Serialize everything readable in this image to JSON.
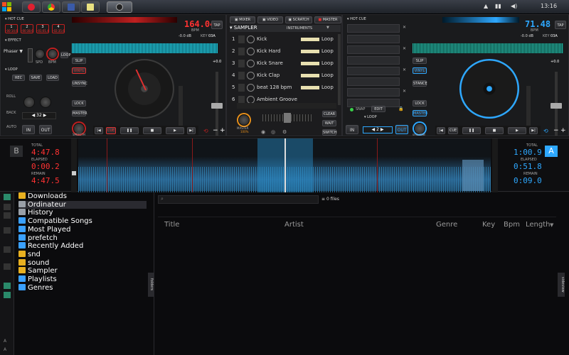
{
  "taskbar": {
    "clock": "13:16"
  },
  "left_deck": {
    "hot_cue_label": "HOT CUE",
    "hot_cues": [
      {
        "num": "1",
        "time": "-00:14.6"
      },
      {
        "num": "2",
        "time": "-00:38.6"
      },
      {
        "num": "3",
        "time": "-01:01.4"
      },
      {
        "num": "4",
        "time": "-02:35.6"
      }
    ],
    "bpm": "164.04",
    "bpm_unit": "BPM",
    "gain": "-0.0 dB",
    "key_label": "KEY",
    "key": "03A",
    "tap": "TAP",
    "effect_label": "EFFECT",
    "effect_name": "Phaser",
    "effect_knobs": [
      "SPD",
      "BPM"
    ],
    "loop_btn": "LOOP",
    "loop_label": "LOOP",
    "loop_buttons": [
      "REC",
      "SAVE",
      "LOAD"
    ],
    "side_labels": [
      "ROLL",
      "BACK",
      "AUTO"
    ],
    "loop_size": "32",
    "loop_in": "IN",
    "loop_out": "OUT",
    "pitch": "+0.0",
    "right_buttons": [
      "SLIP",
      "VINYL",
      "UNSYNC",
      "LOCK",
      "MASTER"
    ],
    "smooth": "SMOOTH",
    "transport": {
      "cue": "CUE"
    }
  },
  "right_deck": {
    "hot_cue_label": "HOT CUE",
    "bpm": "71.48",
    "bpm_unit": "BPM",
    "gain": "-0.0 dB",
    "key_label": "KEY",
    "key": "03A",
    "tap": "TAP",
    "pitch": "+0.0",
    "left_buttons": [
      "SLIP",
      "VINYL",
      "STANCE",
      "LOCK",
      "MASTER"
    ],
    "snap": "SNAP",
    "edit": "EDIT",
    "loop_label": "LOOP",
    "loop_in": "IN",
    "loop_out": "OUT",
    "loop_size": "2",
    "smooth": "smoothB",
    "transport": {
      "cue": "CUE"
    }
  },
  "center": {
    "tabs": [
      "MIXER",
      "VIDEO",
      "SCRATCH",
      "MASTER"
    ],
    "sampler_title": "SAMPLER",
    "sampler_mode": "INSTRUMENTS",
    "samples": [
      {
        "num": "1",
        "name": "Kick",
        "mode": "Loop"
      },
      {
        "num": "2",
        "name": "Kick Hard",
        "mode": "Loop"
      },
      {
        "num": "3",
        "name": "Kick Snare",
        "mode": "Loop"
      },
      {
        "num": "4",
        "name": "Kick Clap",
        "mode": "Loop"
      },
      {
        "num": "5",
        "name": "beat 128 bpm",
        "mode": "Loop"
      },
      {
        "num": "6",
        "name": "Ambient Groove",
        "mode": ""
      }
    ],
    "master_knob_label": "MASTER",
    "master_percent": "100%",
    "side_buttons": [
      "CLEAR",
      "WAIT",
      "SWITCH"
    ]
  },
  "waveform_bar": {
    "left_letter": "B",
    "right_letter": "A",
    "left": {
      "total_label": "TOTAL",
      "total": "4:47.8",
      "elapsed_label": "ELAPSED",
      "elapsed": "0:00.2",
      "remain_label": "REMAIN",
      "remain": "4:47.5"
    },
    "right": {
      "total_label": "TOTAL",
      "total": "1:00.9",
      "elapsed_label": "ELAPSED",
      "elapsed": "0:51.8",
      "remain_label": "REMAIN",
      "remain": "0:09.0"
    }
  },
  "browser": {
    "folders": [
      {
        "label": "Downloads",
        "icon": "folder-icon",
        "color": "#e8b020"
      },
      {
        "label": "Ordinateur",
        "icon": "computer-icon",
        "color": "#9aa0a8"
      },
      {
        "label": "History",
        "icon": "history-icon",
        "color": "#9aa0a8"
      },
      {
        "label": "Compatible Songs",
        "icon": "filter-icon",
        "color": "#3aa0ff"
      },
      {
        "label": "Most Played",
        "icon": "filter-icon",
        "color": "#3aa0ff"
      },
      {
        "label": "prefetch",
        "icon": "filter-icon",
        "color": "#3aa0ff"
      },
      {
        "label": "Recently Added",
        "icon": "filter-icon",
        "color": "#3aa0ff"
      },
      {
        "label": "snd",
        "icon": "folder-icon",
        "color": "#e8b020"
      },
      {
        "label": "sound",
        "icon": "folder-icon",
        "color": "#e8b020"
      },
      {
        "label": "Sampler",
        "icon": "sampler-icon",
        "color": "#e8b020"
      },
      {
        "label": "Playlists",
        "icon": "playlist-icon",
        "color": "#3aa0ff"
      },
      {
        "label": "Genres",
        "icon": "filter-icon",
        "color": "#3aa0ff"
      }
    ],
    "search_placeholder": "",
    "file_count": "0 files",
    "columns": [
      "Title",
      "Artist",
      "Genre",
      "Key",
      "Bpm",
      "Length"
    ],
    "folders_tab": "folders",
    "sideview_tab": "sideview"
  },
  "colors": {
    "accent_left": "#ff3232",
    "accent_right": "#2ea8ff",
    "wave_left": "#22c8d8",
    "wave_right": "#26b0a0"
  }
}
